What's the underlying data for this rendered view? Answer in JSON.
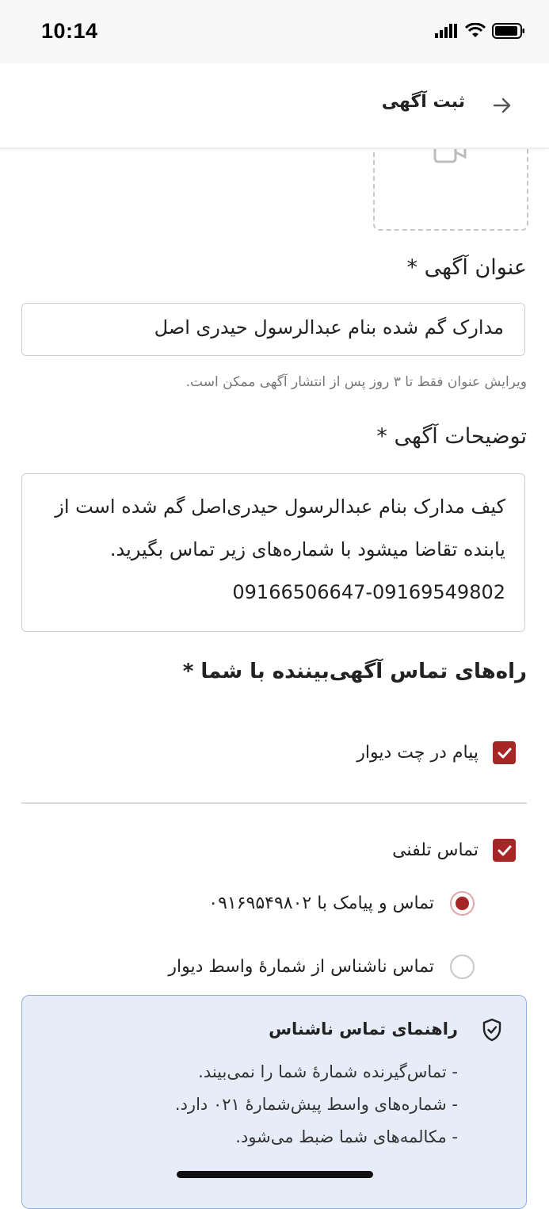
{
  "status_bar": {
    "time": "10:14"
  },
  "header": {
    "title": "ثبت آگهی"
  },
  "title_field": {
    "label": "عنوان آگهی *",
    "value": "مدارک گم شده بنام عبدالرسول حیدری اصل",
    "helper": "ویرایش عنوان فقط تا ۳ روز پس از انتشار آگهی ممکن است."
  },
  "description_field": {
    "label": "توضیحات آگهی *",
    "value": "کیف مدارک بنام عبدالرسول حیدری‌اصل گم شده است از یابنده تقاضا میشود با شماره‌های زیر تماس بگیرید. 09169549802-09166506647"
  },
  "contact": {
    "heading": "راه‌های تماس آگهی‌بیننده با شما *",
    "chat_label": "پیام در چت دیوار",
    "chat_checked": true,
    "phone_label": "تماس تلفنی",
    "phone_checked": true,
    "options": [
      {
        "label": "تماس و پیامک با ۰۹۱۶۹۵۴۹۸۰۲",
        "selected": true
      },
      {
        "label": "تماس ناشناس از شمارهٔ واسط دیوار",
        "selected": false
      }
    ]
  },
  "info_box": {
    "title": "راهنمای تماس ناشناس",
    "lines": [
      "- تماس‌گیرنده شمارهٔ شما را نمی‌بیند.",
      "- شماره‌های واسط پیش‌شمارهٔ ۰۲۱ دارد.",
      "- مکالمه‌های شما ضبط می‌شود."
    ]
  },
  "colors": {
    "accent": "#a62626",
    "info_bg": "#e6edf8",
    "info_border": "#8eb1e2"
  }
}
